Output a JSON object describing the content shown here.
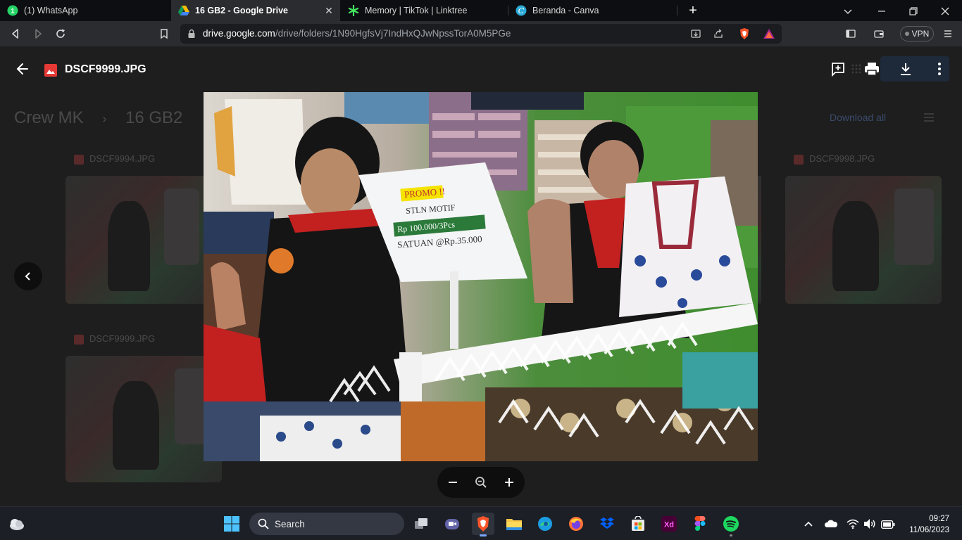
{
  "browser": {
    "tabs": [
      {
        "label": "(1) WhatsApp",
        "icon": "whatsapp-icon"
      },
      {
        "label": "16 GB2 - Google Drive",
        "icon": "google-drive-icon",
        "active": true
      },
      {
        "label": "Memory | TikTok | Linktree",
        "icon": "linktree-icon"
      },
      {
        "label": "Beranda - Canva",
        "icon": "canva-icon"
      }
    ],
    "url_host": "drive.google.com",
    "url_path": "/drive/folders/1N90HgfsVj7IndHxQJwNpssTorA0M5PGe",
    "vpn_label": "VPN"
  },
  "drive": {
    "breadcrumb": [
      "Crew MK",
      "16 GB2"
    ],
    "download_all": "Download all",
    "files": [
      "DSCF9994.JPG",
      "DSCF9998.JPG",
      "DSCF9999.JPG"
    ]
  },
  "viewer": {
    "filename": "DSCF9999.JPG",
    "photo_sign": {
      "line1": "PROMO !!",
      "line2": "STLN MOTIF",
      "line3": "Rp 100.000/3Pcs",
      "line4": "SATUAN @Rp.35.000"
    }
  },
  "taskbar": {
    "search_label": "Search",
    "time": "09:27",
    "date": "11/06/2023"
  },
  "colors": {
    "drive_bg": "#1e1e1e",
    "taskbar_bg": "#1c1f26",
    "accent": "#7aa7ff"
  }
}
